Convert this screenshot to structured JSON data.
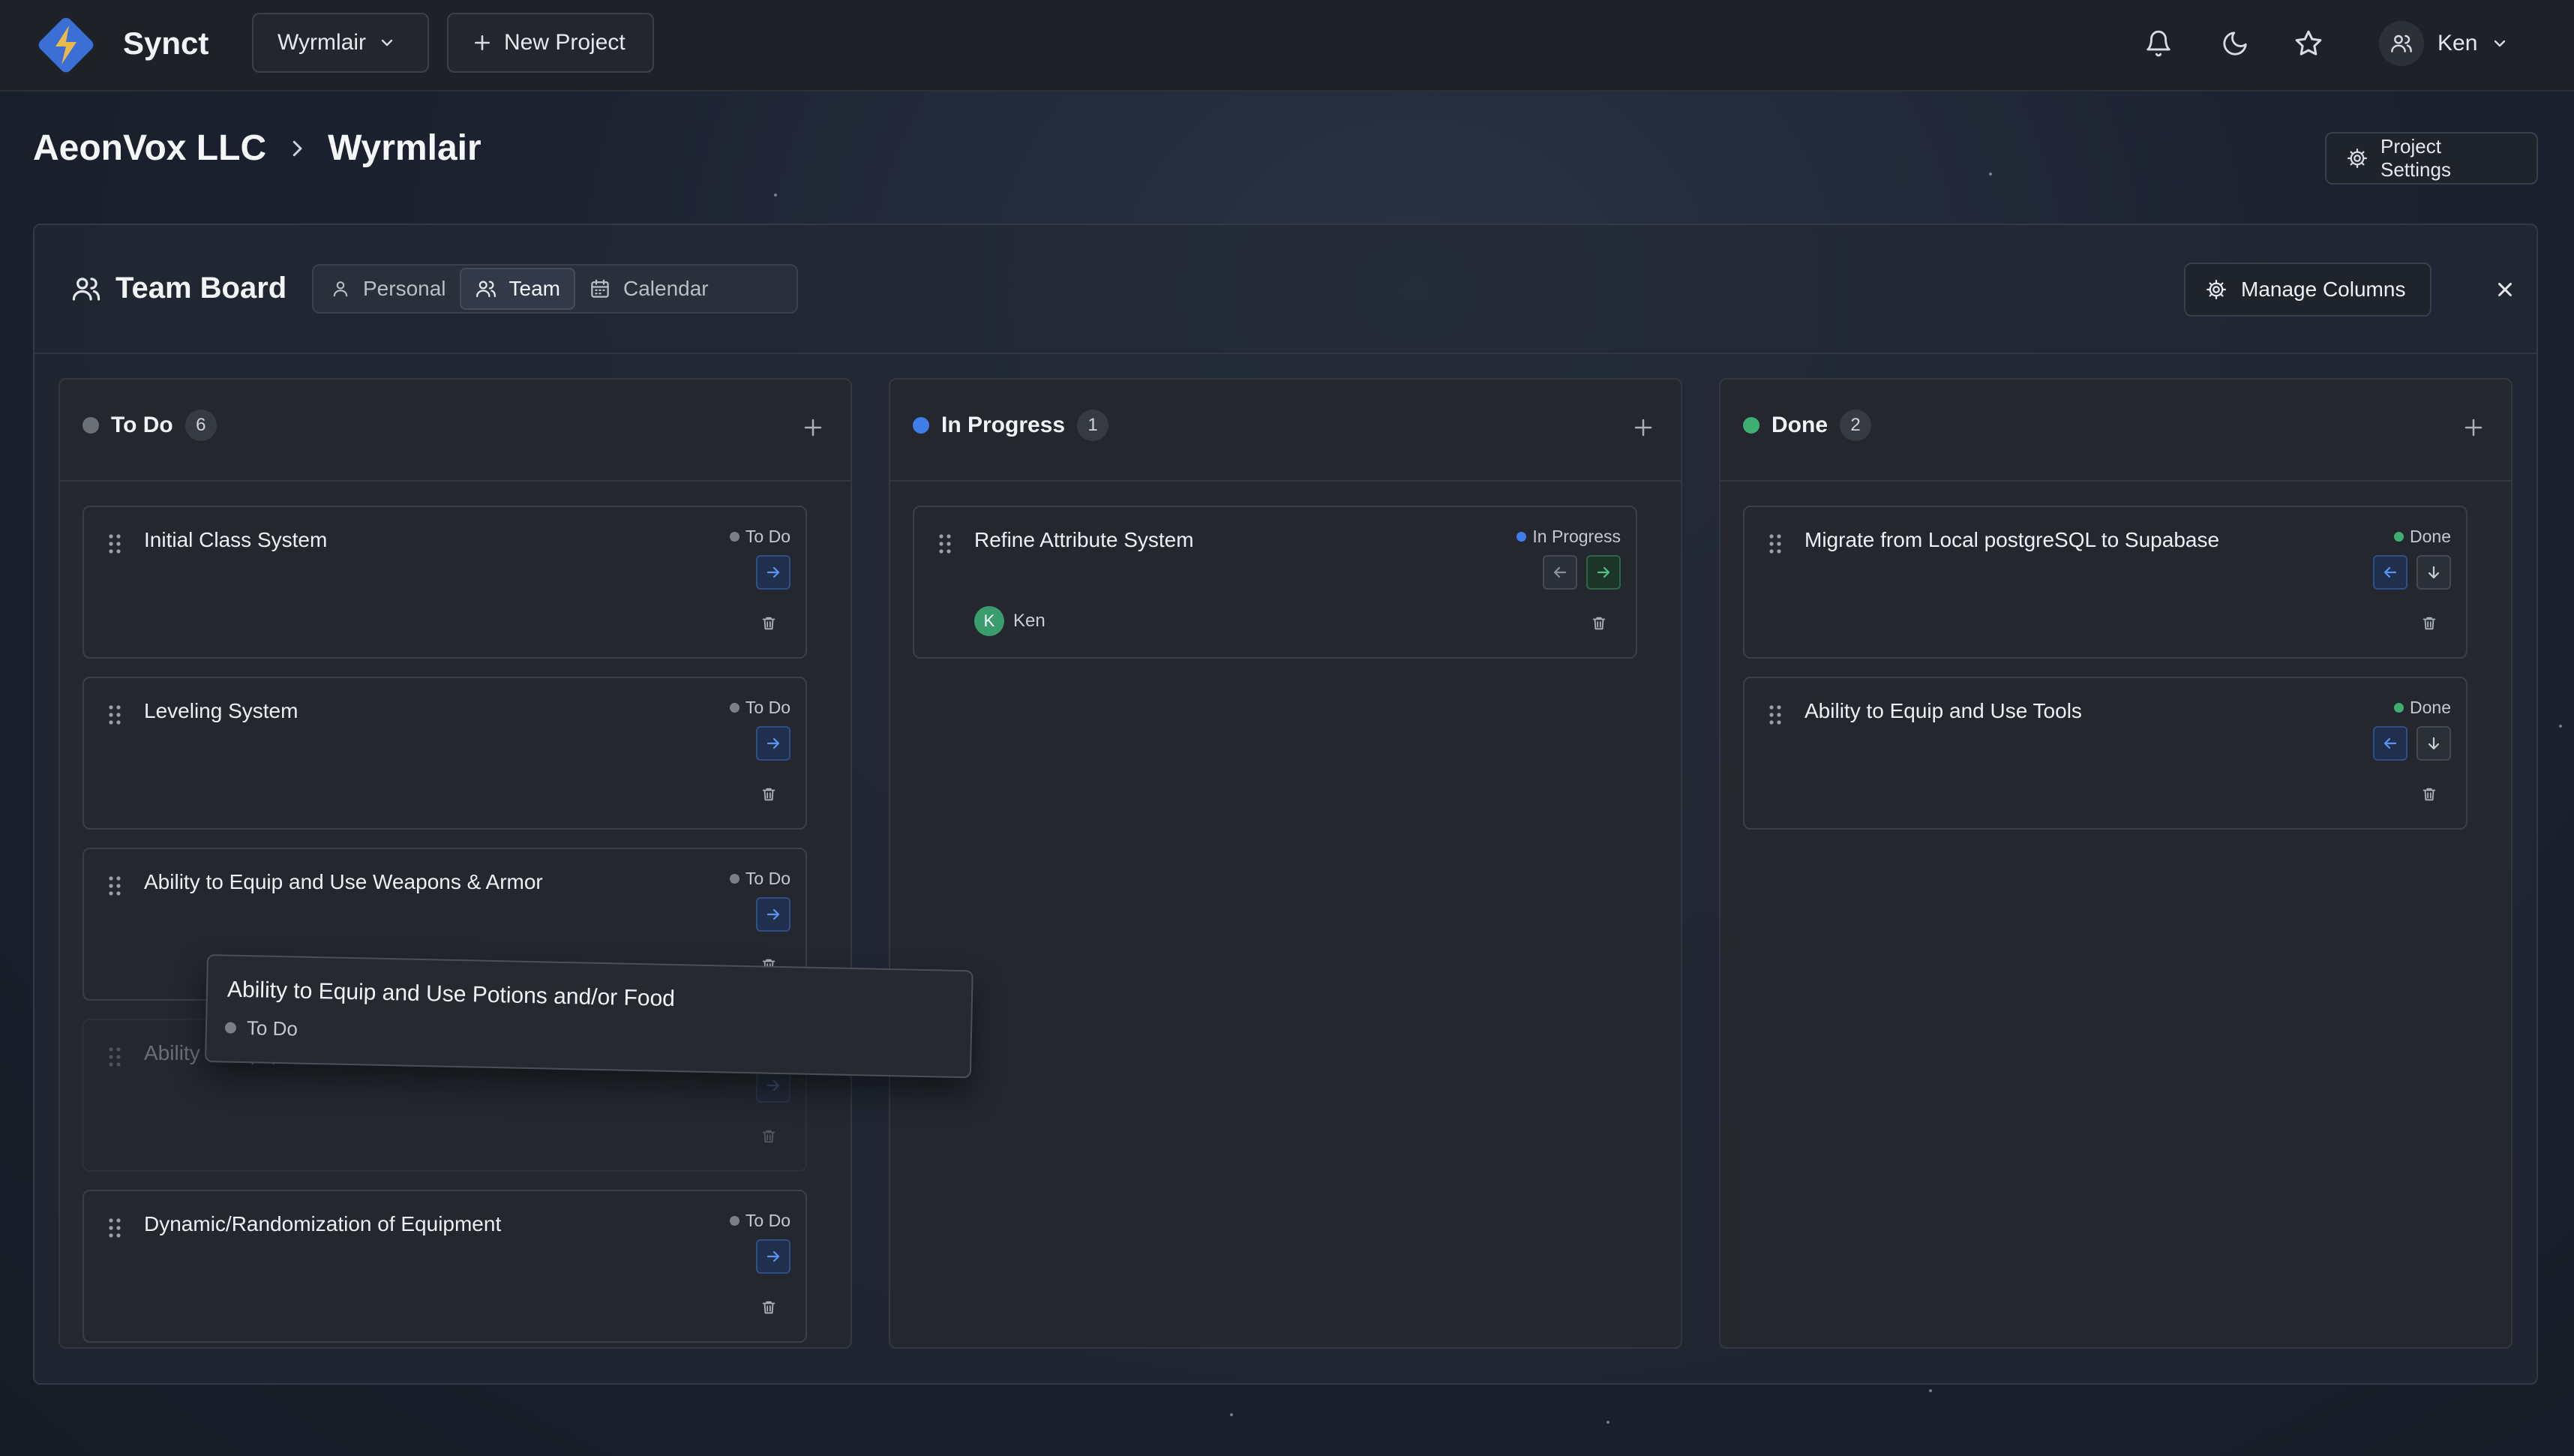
{
  "app": {
    "name": "Synct"
  },
  "nav": {
    "project_selector": "Wyrmlair",
    "new_project": "New Project",
    "user_name": "Ken"
  },
  "breadcrumb": {
    "org": "AeonVox LLC",
    "project": "Wyrmlair"
  },
  "project_settings": "Project Settings",
  "board": {
    "title": "Team Board",
    "tabs": [
      {
        "label": "Personal",
        "icon": "user-icon"
      },
      {
        "label": "Team",
        "icon": "users-icon"
      },
      {
        "label": "Calendar",
        "icon": "calendar-icon"
      }
    ],
    "active_tab": "Team",
    "manage_columns": "Manage Columns"
  },
  "columns": [
    {
      "name": "To Do",
      "count": "6",
      "color": "#6b7079",
      "cards": [
        {
          "title": "Initial Class System",
          "status": "To Do"
        },
        {
          "title": "Leveling System",
          "status": "To Do"
        },
        {
          "title": "Ability to Equip and Use Weapons & Armor",
          "status": "To Do"
        },
        {
          "title": "Ability to Equip and Use Potions and/or Food",
          "status": "To Do"
        },
        {
          "title": "Dynamic/Randomization of Equipment",
          "status": "To Do"
        }
      ]
    },
    {
      "name": "In Progress",
      "count": "1",
      "color": "#3f7de8",
      "cards": [
        {
          "title": "Refine Attribute System",
          "status": "In Progress",
          "assignee": "Ken",
          "assignee_initial": "K"
        }
      ]
    },
    {
      "name": "Done",
      "count": "2",
      "color": "#3fae72",
      "cards": [
        {
          "title": "Migrate from Local postgreSQL to Supabase",
          "status": "Done"
        },
        {
          "title": "Ability to Equip and Use Tools",
          "status": "Done"
        }
      ]
    }
  ],
  "dragging_card": {
    "title": "Ability to Equip and Use Potions and/or Food",
    "status": "To Do"
  },
  "colors": {
    "accent_blue": "#3f7de8",
    "done_green": "#3fae72",
    "todo_gray": "#6b7079",
    "logo_blue": "#3b6fd6",
    "logo_gold": "#e9b949"
  }
}
